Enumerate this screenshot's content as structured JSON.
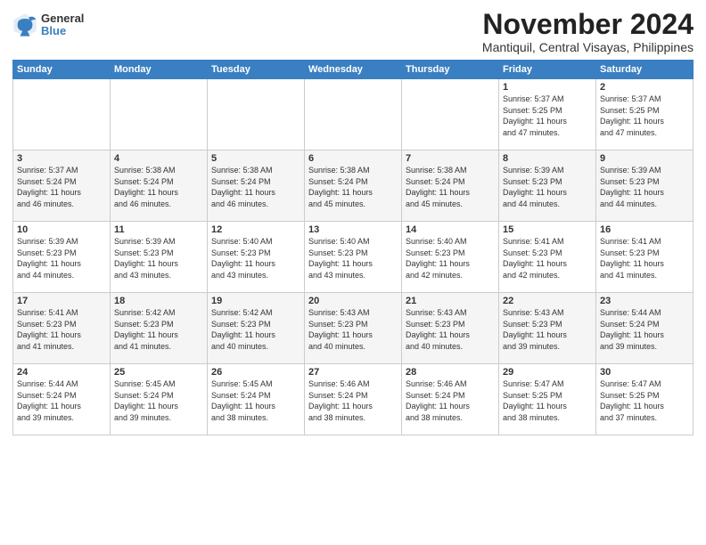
{
  "header": {
    "logo": {
      "general": "General",
      "blue": "Blue"
    },
    "title": "November 2024",
    "location": "Mantiquil, Central Visayas, Philippines"
  },
  "calendar": {
    "days": [
      "Sunday",
      "Monday",
      "Tuesday",
      "Wednesday",
      "Thursday",
      "Friday",
      "Saturday"
    ],
    "weeks": [
      [
        {
          "day": "",
          "info": ""
        },
        {
          "day": "",
          "info": ""
        },
        {
          "day": "",
          "info": ""
        },
        {
          "day": "",
          "info": ""
        },
        {
          "day": "",
          "info": ""
        },
        {
          "day": "1",
          "info": "Sunrise: 5:37 AM\nSunset: 5:25 PM\nDaylight: 11 hours\nand 47 minutes."
        },
        {
          "day": "2",
          "info": "Sunrise: 5:37 AM\nSunset: 5:25 PM\nDaylight: 11 hours\nand 47 minutes."
        }
      ],
      [
        {
          "day": "3",
          "info": "Sunrise: 5:37 AM\nSunset: 5:24 PM\nDaylight: 11 hours\nand 46 minutes."
        },
        {
          "day": "4",
          "info": "Sunrise: 5:38 AM\nSunset: 5:24 PM\nDaylight: 11 hours\nand 46 minutes."
        },
        {
          "day": "5",
          "info": "Sunrise: 5:38 AM\nSunset: 5:24 PM\nDaylight: 11 hours\nand 46 minutes."
        },
        {
          "day": "6",
          "info": "Sunrise: 5:38 AM\nSunset: 5:24 PM\nDaylight: 11 hours\nand 45 minutes."
        },
        {
          "day": "7",
          "info": "Sunrise: 5:38 AM\nSunset: 5:24 PM\nDaylight: 11 hours\nand 45 minutes."
        },
        {
          "day": "8",
          "info": "Sunrise: 5:39 AM\nSunset: 5:23 PM\nDaylight: 11 hours\nand 44 minutes."
        },
        {
          "day": "9",
          "info": "Sunrise: 5:39 AM\nSunset: 5:23 PM\nDaylight: 11 hours\nand 44 minutes."
        }
      ],
      [
        {
          "day": "10",
          "info": "Sunrise: 5:39 AM\nSunset: 5:23 PM\nDaylight: 11 hours\nand 44 minutes."
        },
        {
          "day": "11",
          "info": "Sunrise: 5:39 AM\nSunset: 5:23 PM\nDaylight: 11 hours\nand 43 minutes."
        },
        {
          "day": "12",
          "info": "Sunrise: 5:40 AM\nSunset: 5:23 PM\nDaylight: 11 hours\nand 43 minutes."
        },
        {
          "day": "13",
          "info": "Sunrise: 5:40 AM\nSunset: 5:23 PM\nDaylight: 11 hours\nand 43 minutes."
        },
        {
          "day": "14",
          "info": "Sunrise: 5:40 AM\nSunset: 5:23 PM\nDaylight: 11 hours\nand 42 minutes."
        },
        {
          "day": "15",
          "info": "Sunrise: 5:41 AM\nSunset: 5:23 PM\nDaylight: 11 hours\nand 42 minutes."
        },
        {
          "day": "16",
          "info": "Sunrise: 5:41 AM\nSunset: 5:23 PM\nDaylight: 11 hours\nand 41 minutes."
        }
      ],
      [
        {
          "day": "17",
          "info": "Sunrise: 5:41 AM\nSunset: 5:23 PM\nDaylight: 11 hours\nand 41 minutes."
        },
        {
          "day": "18",
          "info": "Sunrise: 5:42 AM\nSunset: 5:23 PM\nDaylight: 11 hours\nand 41 minutes."
        },
        {
          "day": "19",
          "info": "Sunrise: 5:42 AM\nSunset: 5:23 PM\nDaylight: 11 hours\nand 40 minutes."
        },
        {
          "day": "20",
          "info": "Sunrise: 5:43 AM\nSunset: 5:23 PM\nDaylight: 11 hours\nand 40 minutes."
        },
        {
          "day": "21",
          "info": "Sunrise: 5:43 AM\nSunset: 5:23 PM\nDaylight: 11 hours\nand 40 minutes."
        },
        {
          "day": "22",
          "info": "Sunrise: 5:43 AM\nSunset: 5:23 PM\nDaylight: 11 hours\nand 39 minutes."
        },
        {
          "day": "23",
          "info": "Sunrise: 5:44 AM\nSunset: 5:24 PM\nDaylight: 11 hours\nand 39 minutes."
        }
      ],
      [
        {
          "day": "24",
          "info": "Sunrise: 5:44 AM\nSunset: 5:24 PM\nDaylight: 11 hours\nand 39 minutes."
        },
        {
          "day": "25",
          "info": "Sunrise: 5:45 AM\nSunset: 5:24 PM\nDaylight: 11 hours\nand 39 minutes."
        },
        {
          "day": "26",
          "info": "Sunrise: 5:45 AM\nSunset: 5:24 PM\nDaylight: 11 hours\nand 38 minutes."
        },
        {
          "day": "27",
          "info": "Sunrise: 5:46 AM\nSunset: 5:24 PM\nDaylight: 11 hours\nand 38 minutes."
        },
        {
          "day": "28",
          "info": "Sunrise: 5:46 AM\nSunset: 5:24 PM\nDaylight: 11 hours\nand 38 minutes."
        },
        {
          "day": "29",
          "info": "Sunrise: 5:47 AM\nSunset: 5:25 PM\nDaylight: 11 hours\nand 38 minutes."
        },
        {
          "day": "30",
          "info": "Sunrise: 5:47 AM\nSunset: 5:25 PM\nDaylight: 11 hours\nand 37 minutes."
        }
      ]
    ]
  }
}
